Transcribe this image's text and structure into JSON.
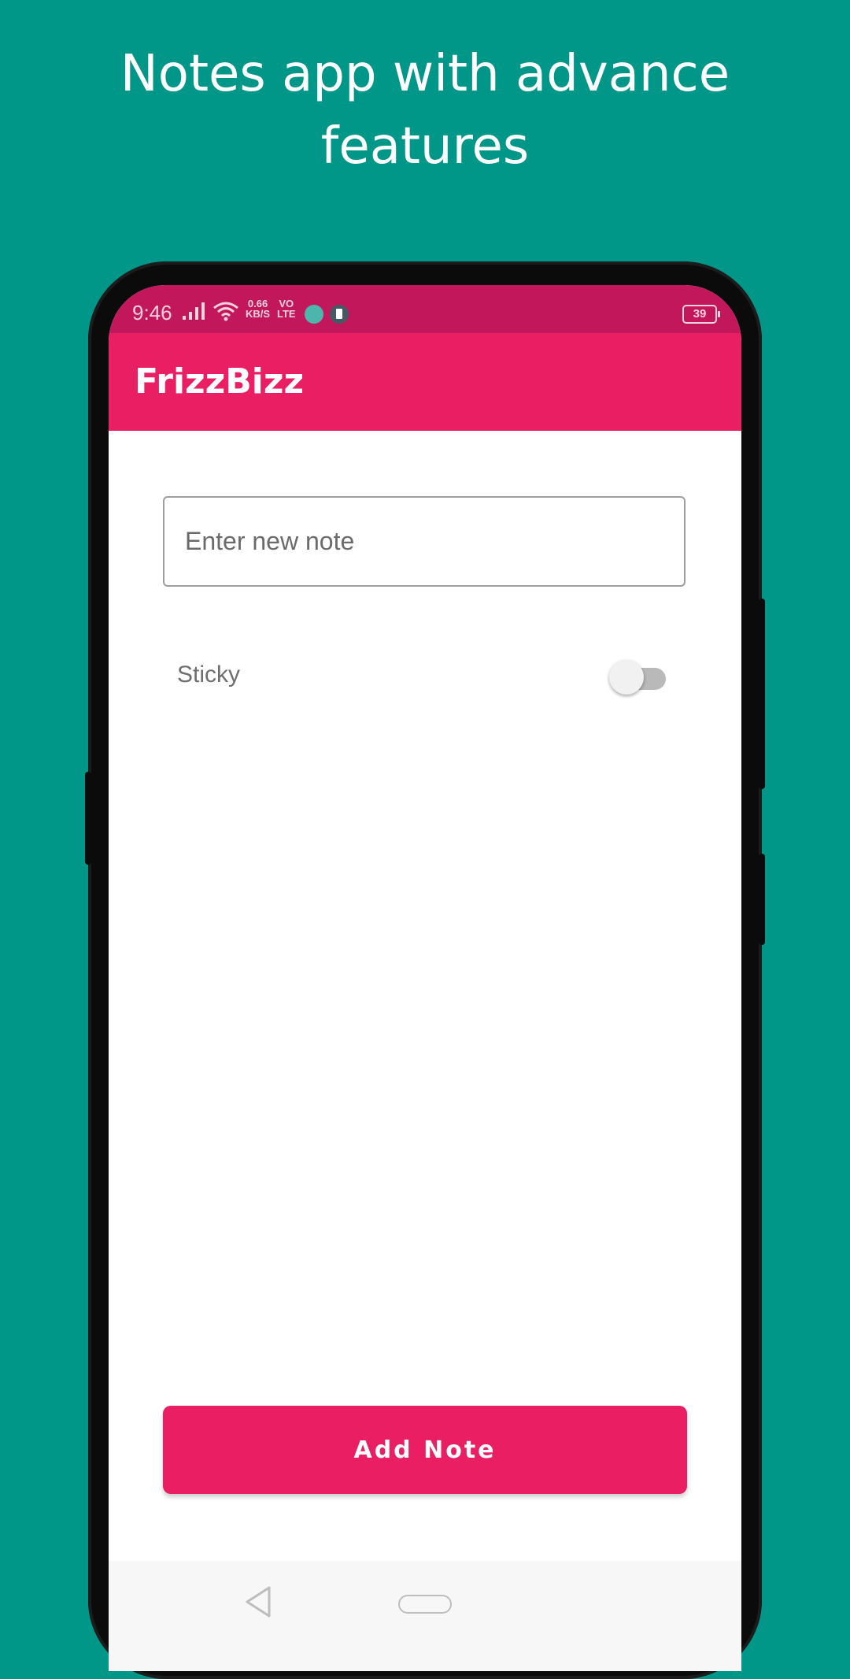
{
  "promo": {
    "line1": "Notes app with advance",
    "line2": "features"
  },
  "statusbar": {
    "time": "9:46",
    "net_speed_value": "0.66",
    "net_speed_unit": "KB/S",
    "volte_top": "VO",
    "volte_bottom": "LTE",
    "battery": "39"
  },
  "appbar": {
    "title": "FrizzBizz"
  },
  "form": {
    "note_placeholder": "Enter new note",
    "note_value": "",
    "sticky_label": "Sticky",
    "sticky_on": false,
    "add_button_label": "Add Note"
  },
  "colors": {
    "background": "#009688",
    "primary": "#e91e63",
    "primary_dark": "#c2185b"
  },
  "icons": [
    "signal-icon",
    "wifi-icon",
    "android-icon",
    "sim-icon",
    "battery-icon",
    "nav-back-icon",
    "nav-home-icon"
  ]
}
